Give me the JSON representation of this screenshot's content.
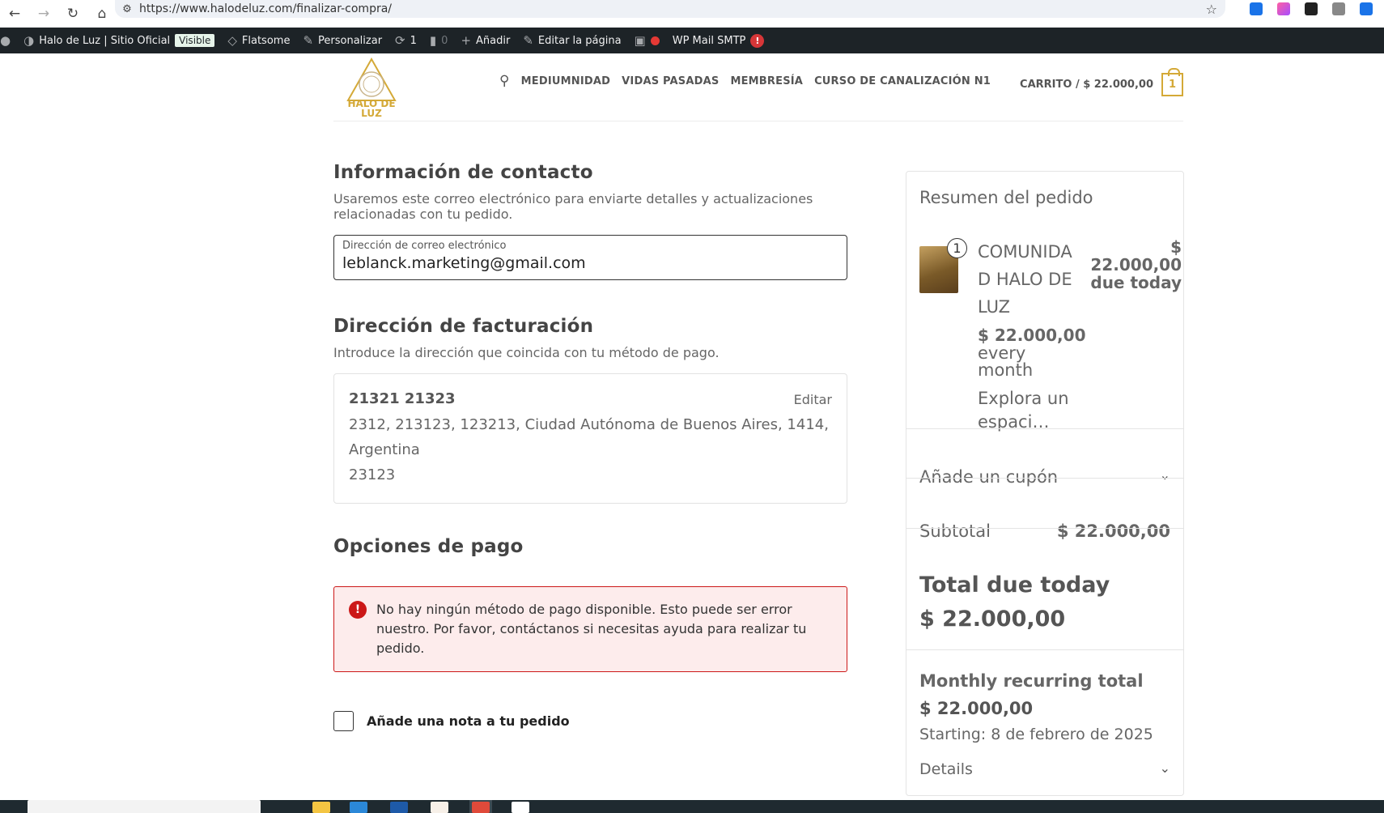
{
  "browser": {
    "url": "https://www.halodeluz.com/finalizar-compra/"
  },
  "adminbar": {
    "site_name": "Halo de Luz | Sitio Oficial",
    "visible_badge": "Visible",
    "theme": "Flatsome",
    "customize": "Personalizar",
    "updates_count": "1",
    "comments_count": "0",
    "add": "Añadir",
    "edit_page": "Editar la página",
    "smtp": "WP Mail SMTP",
    "smtp_badge": "!"
  },
  "header": {
    "logo_line1": "HALO DE",
    "logo_line2": "LUZ",
    "nav": [
      "MEDIUMNIDAD",
      "VIDAS PASADAS",
      "MEMBRESÍA",
      "CURSO DE CANALIZACIÓN N1"
    ],
    "cart_label": "CARRITO / $ 22.000,00",
    "cart_count": "1"
  },
  "contact": {
    "title": "Información de contacto",
    "description": "Usaremos este correo electrónico para enviarte detalles y actualizaciones relacionadas con tu pedido.",
    "email_label": "Dirección de correo electrónico",
    "email_value": "leblanck.marketing@gmail.com"
  },
  "billing": {
    "title": "Dirección de facturación",
    "description": "Introduce la dirección que coincida con tu método de pago.",
    "name": "21321 21323",
    "address_line1": "2312, 213123, 123213, Ciudad Autónoma de Buenos Aires, 1414,",
    "address_line2": "Argentina",
    "phone": "23123",
    "edit_label": "Editar"
  },
  "payment": {
    "title": "Opciones de pago",
    "error": "No hay ningún método de pago disponible. Esto puede ser error nuestro. Por favor, contáctanos si necesitas ayuda para realizar tu pedido.",
    "error_icon": "!"
  },
  "note": {
    "label": "Añade una nota a tu pedido"
  },
  "summary": {
    "title": "Resumen del pedido",
    "qty": "1",
    "product_name": "COMUNIDAD HALO DE LUZ",
    "price_right_amount": "$ 22.000,00",
    "price_right_suffix": "due today",
    "price": "$ 22.000,00",
    "every": "every month",
    "excerpt": "Explora un espaci…",
    "coupon": "Añade un cupón",
    "subtotal_label": "Subtotal",
    "subtotal_value": "$ 22.000,00",
    "total_label": "Total due today",
    "total_value": "$ 22.000,00",
    "recurring_title": "Monthly recurring total",
    "recurring_value": "$ 22.000,00",
    "starting": "Starting: 8 de febrero de 2025",
    "details": "Details"
  },
  "colors": {
    "brand_gold": "#d4a937",
    "error_red": "#cc1818",
    "admin_bar": "#1d2327"
  }
}
